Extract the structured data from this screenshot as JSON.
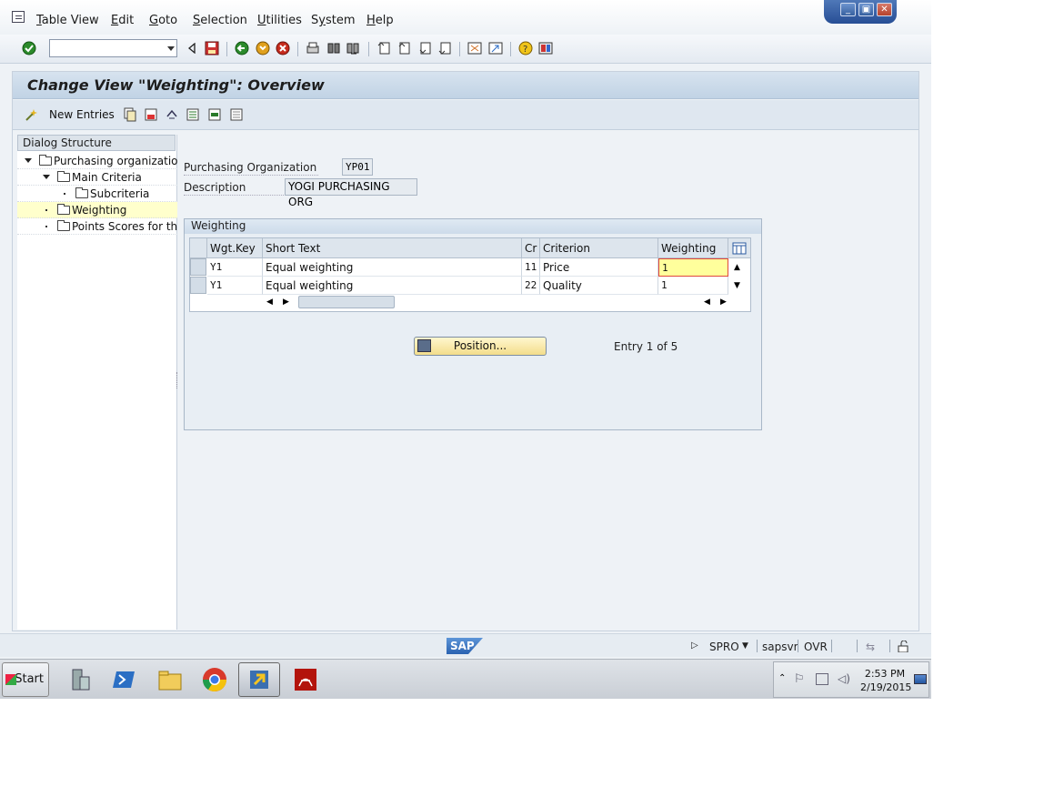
{
  "menubar": {
    "items": [
      {
        "label": "Table View",
        "u": "T"
      },
      {
        "label": "Edit",
        "u": "E"
      },
      {
        "label": "Goto",
        "u": "G"
      },
      {
        "label": "Selection",
        "u": "S"
      },
      {
        "label": "Utilities",
        "u": "U"
      },
      {
        "label": "System",
        "u": "y"
      },
      {
        "label": "Help",
        "u": "H"
      }
    ]
  },
  "window_controls": {
    "minimize": "_",
    "restore": "▣",
    "close": "✕"
  },
  "command_field": {
    "value": ""
  },
  "screen_title": "Change View \"Weighting\": Overview",
  "app_toolbar": {
    "new_entries_label": "New Entries"
  },
  "dialog_structure": {
    "header": "Dialog Structure",
    "items": [
      {
        "label": "Purchasing organization"
      },
      {
        "label": "Main Criteria"
      },
      {
        "label": "Subcriteria"
      },
      {
        "label": "Weighting"
      },
      {
        "label": "Points Scores for the"
      }
    ]
  },
  "header_fields": {
    "purch_org_label": "Purchasing Organization",
    "purch_org_value": "YP01",
    "description_label": "Description",
    "description_value": "YOGI PURCHASING ORG"
  },
  "weighting": {
    "title": "Weighting",
    "columns": [
      "Wgt.Key",
      "Short Text",
      "Cr",
      "Criterion",
      "Weighting"
    ],
    "rows": [
      {
        "key": "Y1",
        "short_text": "Equal weighting",
        "cr": "11",
        "criterion": "Price",
        "weighting": "1"
      },
      {
        "key": "Y1",
        "short_text": "Equal weighting",
        "cr": "22",
        "criterion": "Quality",
        "weighting": "1"
      }
    ],
    "position_button": "Position...",
    "entry_text": "Entry 1 of 5"
  },
  "statusbar": {
    "logo": "SAP",
    "transaction": "SPRO",
    "server": "sapsvr",
    "mode": "OVR"
  },
  "taskbar": {
    "start_label": "Start",
    "time": "2:53 PM",
    "date": "2/19/2015"
  },
  "colors": {
    "selected_row": "#ffffcc",
    "edit_cell": "#ffff9c",
    "title_bar": "#c1d3e5"
  }
}
